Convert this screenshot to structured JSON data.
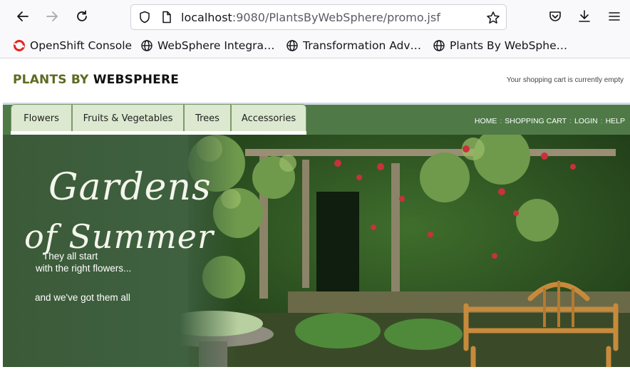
{
  "browser": {
    "url_host": "localhost",
    "url_rest": ":9080/PlantsByWebSphere/promo.jsf",
    "back_icon": "arrow-left-icon",
    "forward_icon": "arrow-right-icon",
    "reload_icon": "reload-icon",
    "bookmarks": [
      {
        "label": "OpenShift Console",
        "icon": "openshift-icon",
        "color": "#e5261b"
      },
      {
        "label": "WebSphere Integra…",
        "icon": "globe-icon"
      },
      {
        "label": "Transformation Adv…",
        "icon": "globe-icon"
      },
      {
        "label": "Plants By WebSphe…",
        "icon": "globe-icon"
      }
    ]
  },
  "site": {
    "logo_part1": "PLANTS BY ",
    "logo_part2": "WEBSPHERE",
    "cart_message": "Your shopping cart is currently empty",
    "tabs": [
      "Flowers",
      "Fruits & Vegetables",
      "Trees",
      "Accessories"
    ],
    "top_links": [
      "HOME",
      "SHOPPING CART",
      "LOGIN",
      "HELP"
    ],
    "top_link_separator": ":"
  },
  "banner": {
    "title_line1": "Gardens",
    "title_line2": "of Summer",
    "tagline1": "They all start",
    "tagline2": "with the right flowers...",
    "tagline3": "and we've got them all"
  }
}
